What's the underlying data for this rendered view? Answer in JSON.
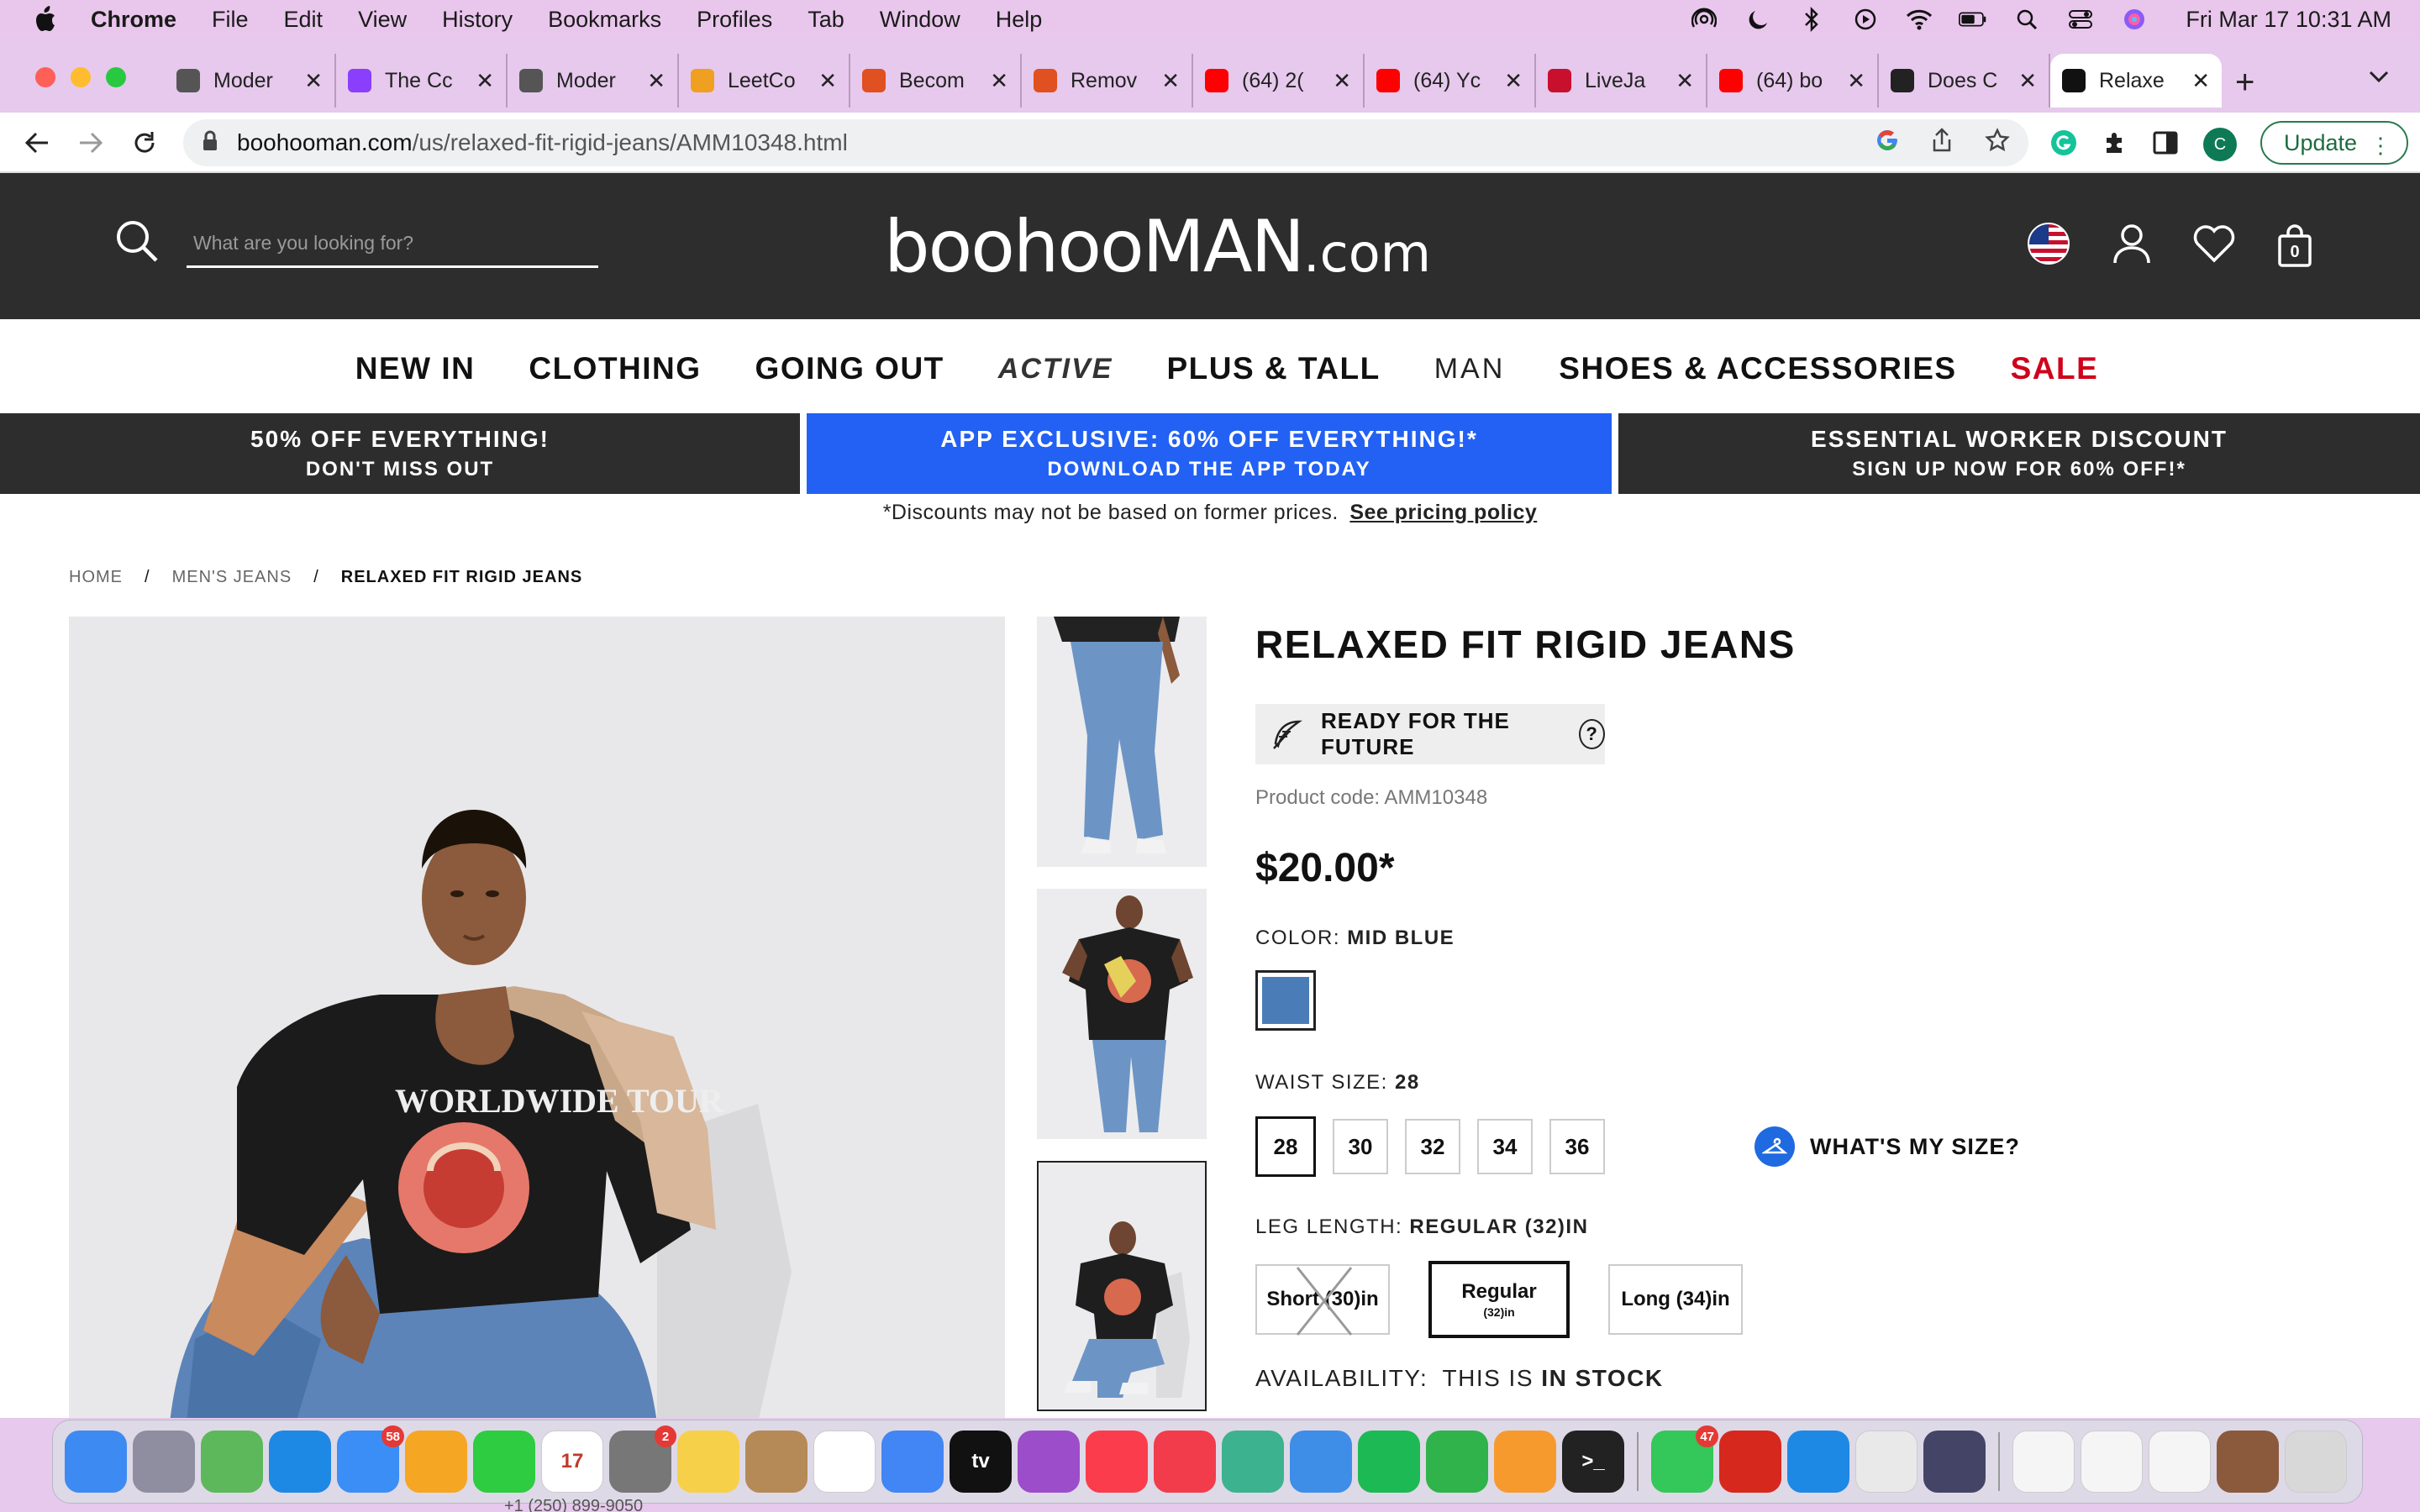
{
  "menubar": {
    "app_name": "Chrome",
    "items": [
      "File",
      "Edit",
      "View",
      "History",
      "Bookmarks",
      "Profiles",
      "Tab",
      "Window",
      "Help"
    ],
    "clock": "Fri Mar 17  10:31 AM"
  },
  "tabs": [
    {
      "title": "Moder",
      "favicon": "globe-icon",
      "color": "#555555"
    },
    {
      "title": "The Cc",
      "favicon": "purple-u-icon",
      "color": "#8a3ffc"
    },
    {
      "title": "Moder",
      "favicon": "globe-icon",
      "color": "#555555"
    },
    {
      "title": "LeetCo",
      "favicon": "leetcode-icon",
      "color": "#f0a020"
    },
    {
      "title": "Becom",
      "favicon": "c-icon",
      "color": "#e05020"
    },
    {
      "title": "Remov",
      "favicon": "c-icon",
      "color": "#e05020"
    },
    {
      "title": "(64) 2(",
      "favicon": "youtube-icon",
      "color": "#ff0000"
    },
    {
      "title": "(64) Yc",
      "favicon": "youtube-icon",
      "color": "#ff0000"
    },
    {
      "title": "LiveJa",
      "favicon": "livejasmin-icon",
      "color": "#c8102e"
    },
    {
      "title": "(64) bo",
      "favicon": "youtube-icon",
      "color": "#ff0000"
    },
    {
      "title": "Does C",
      "favicon": "boohoo-icon",
      "color": "#222222"
    },
    {
      "title": "Relaxe",
      "favicon": "boohooman-icon",
      "color": "#111111",
      "active": true
    }
  ],
  "address": {
    "domain": "boohooman.com",
    "path": "/us/relaxed-fit-rigid-jeans/AMM10348.html",
    "profile_initial": "C",
    "update_label": "Update"
  },
  "site": {
    "search_placeholder": "What are you looking for?",
    "logo_main": "boohooMAN",
    "logo_suffix": ".com",
    "basket_count": "0",
    "nav": [
      "NEW IN",
      "CLOTHING",
      "GOING OUT",
      "ACTIVE",
      "PLUS & TALL",
      "MAN",
      "SHOES & ACCESSORIES",
      "SALE"
    ],
    "promos": [
      {
        "line1": "50% OFF EVERYTHING!",
        "line2": "DON'T MISS OUT"
      },
      {
        "line1": "APP EXCLUSIVE: 60% OFF EVERYTHING!*",
        "line2": "DOWNLOAD THE APP TODAY"
      },
      {
        "line1": "ESSENTIAL WORKER DISCOUNT",
        "line2": "SIGN UP NOW FOR 60% OFF!*"
      }
    ],
    "disclaimer": "*Discounts may not be based on former prices.",
    "disclaimer_link": "See pricing policy",
    "breadcrumb": [
      "HOME",
      "/",
      "MEN'S JEANS",
      "/",
      "RELAXED FIT RIGID JEANS"
    ],
    "main_image_text": "WORLDWIDE TOUR"
  },
  "product": {
    "title": "RELAXED FIT RIGID JEANS",
    "future_label": "READY FOR THE FUTURE",
    "code_label": "Product code: AMM10348",
    "price": "$20.00*",
    "color_label": "COLOR:",
    "color_value": "MID BLUE",
    "waist_label": "WAIST SIZE:",
    "waist_value": "28",
    "sizes": [
      "28",
      "30",
      "32",
      "34",
      "36"
    ],
    "whats_my_size": "WHAT'S MY SIZE?",
    "leg_label": "LEG LENGTH:",
    "leg_value": "REGULAR (32)IN",
    "lengths": [
      {
        "label": "Short (30)in",
        "sub": ""
      },
      {
        "label": "Regular",
        "sub": "(32)in"
      },
      {
        "label": "Long (34)in",
        "sub": ""
      }
    ],
    "availability_label": "AVAILABILITY:",
    "availability_mid": "THIS IS",
    "availability_value": "IN STOCK"
  },
  "dock": {
    "apps": [
      {
        "name": "finder-icon",
        "color": "#3d8bf2",
        "glyph": ""
      },
      {
        "name": "launchpad-icon",
        "color": "#8e8ea0",
        "glyph": ""
      },
      {
        "name": "maps-icon",
        "color": "#5db85c",
        "glyph": ""
      },
      {
        "name": "safari-icon",
        "color": "#1e88e5",
        "glyph": ""
      },
      {
        "name": "mail-icon",
        "color": "#3a8ef6",
        "glyph": "",
        "badge": "58"
      },
      {
        "name": "photos-icon",
        "color": "#f5a623",
        "glyph": ""
      },
      {
        "name": "facetime-icon",
        "color": "#2ecc40",
        "glyph": ""
      },
      {
        "name": "calendar-icon",
        "color": "#ffffff",
        "glyph": "17"
      },
      {
        "name": "system-settings-icon",
        "color": "#777777",
        "glyph": "",
        "badge": "2"
      },
      {
        "name": "notes-icon",
        "color": "#f7d04a",
        "glyph": ""
      },
      {
        "name": "contacts-icon",
        "color": "#b58a56",
        "glyph": ""
      },
      {
        "name": "reminders-icon",
        "color": "#ffffff",
        "glyph": ""
      },
      {
        "name": "chrome-icon",
        "color": "#4285f4",
        "glyph": ""
      },
      {
        "name": "apple-tv-icon",
        "color": "#111111",
        "glyph": "tv"
      },
      {
        "name": "podcasts-icon",
        "color": "#9b4dca",
        "glyph": ""
      },
      {
        "name": "music-icon",
        "color": "#fa3c4c",
        "glyph": ""
      },
      {
        "name": "news-icon",
        "color": "#f23c4c",
        "glyph": ""
      },
      {
        "name": "atom-icon",
        "color": "#3db28f",
        "glyph": ""
      },
      {
        "name": "keynote-icon",
        "color": "#3e8ee8",
        "glyph": ""
      },
      {
        "name": "spotify-icon",
        "color": "#1db954",
        "glyph": ""
      },
      {
        "name": "numbers-icon",
        "color": "#2fb34a",
        "glyph": ""
      },
      {
        "name": "pages-icon",
        "color": "#f79a2e",
        "glyph": ""
      },
      {
        "name": "terminal-icon",
        "color": "#222222",
        "glyph": ">_"
      },
      {
        "name": "messages-icon",
        "color": "#34c759",
        "glyph": "",
        "badge": "47"
      },
      {
        "name": "acrobat-icon",
        "color": "#d7281d",
        "glyph": ""
      },
      {
        "name": "vscode-icon",
        "color": "#1e88e5",
        "glyph": ""
      },
      {
        "name": "java-icon",
        "color": "#e9e9e9",
        "glyph": ""
      },
      {
        "name": "screen-recorder-icon",
        "color": "#444466",
        "glyph": ""
      },
      {
        "name": "doc-preview-1-icon",
        "color": "#f5f5f5",
        "glyph": ""
      },
      {
        "name": "doc-preview-2-icon",
        "color": "#f5f5f5",
        "glyph": ""
      },
      {
        "name": "doc-preview-3-icon",
        "color": "#f5f5f5",
        "glyph": ""
      },
      {
        "name": "photo-preview-icon",
        "color": "#8b5a3c",
        "glyph": ""
      },
      {
        "name": "trash-icon",
        "color": "#d8d8d8",
        "glyph": ""
      }
    ],
    "footer_text": "+1 (250) 899-9050"
  }
}
